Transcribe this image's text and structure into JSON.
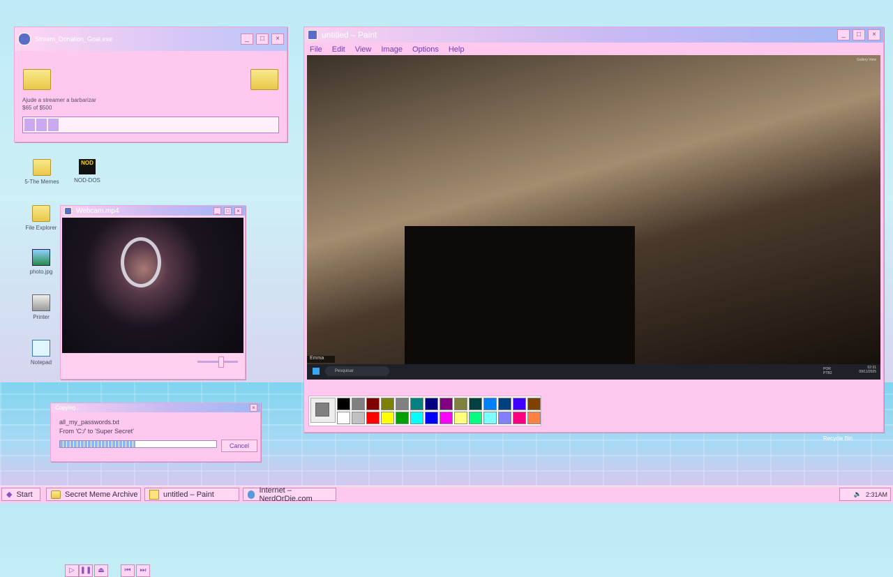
{
  "desktop_icons": [
    {
      "label": "5-The Memes",
      "icon": "folder-icon"
    },
    {
      "label": "NOD-DOS",
      "icon": "nod-icon"
    },
    {
      "label": "File Explorer",
      "icon": "magnifier-icon"
    },
    {
      "label": "photo.jpg",
      "icon": "image-icon"
    },
    {
      "label": "Printer",
      "icon": "printer-icon"
    },
    {
      "label": "Notepad",
      "icon": "notepad-icon"
    },
    {
      "label": "Recycle Bin",
      "icon": "recycle-bin-icon"
    }
  ],
  "donation": {
    "title": "Stream_Donation_Goal.exe",
    "message": "Ajude a streamer a barbarizar",
    "amount": "$65 of $500",
    "progress_fraction": 0.13
  },
  "webcam": {
    "title": "Webcam.mp4"
  },
  "copy_dialog": {
    "title": "Copying...",
    "file": "all_my_passwords.txt",
    "from_to": "From 'C:/' to 'Super Secret'",
    "cancel_label": "Cancel",
    "progress_fraction": 0.48
  },
  "paint": {
    "title": "untitled – Paint",
    "menu": [
      "File",
      "Edit",
      "View",
      "Image",
      "Options",
      "Help"
    ],
    "inner": {
      "gallery_label": "Gallery View",
      "name_tag": "Emma",
      "search_placeholder": "Pesquisar",
      "lang": "POR PTB2",
      "clock_time": "02:31",
      "clock_date": "09/11/2025"
    },
    "palette_top": [
      "#000000",
      "#808080",
      "#800000",
      "#808000",
      "#808080",
      "#008080",
      "#000080",
      "#800080",
      "#808040",
      "#004040",
      "#0080ff",
      "#004080",
      "#4000ff",
      "#804000"
    ],
    "palette_bottom": [
      "#ffffff",
      "#c0c0c0",
      "#ff0000",
      "#ffff00",
      "#00a000",
      "#00ffff",
      "#0000ff",
      "#ff00ff",
      "#ffff80",
      "#00ff80",
      "#80ffff",
      "#8080ff",
      "#ff0080",
      "#ff8040"
    ],
    "current_color": "#808080"
  },
  "taskbar": {
    "start_label": "Start",
    "items": [
      "Secret Meme Archive",
      "untitled – Paint",
      "Internet – NerdOrDie.com"
    ],
    "clock": "2:31AM"
  }
}
